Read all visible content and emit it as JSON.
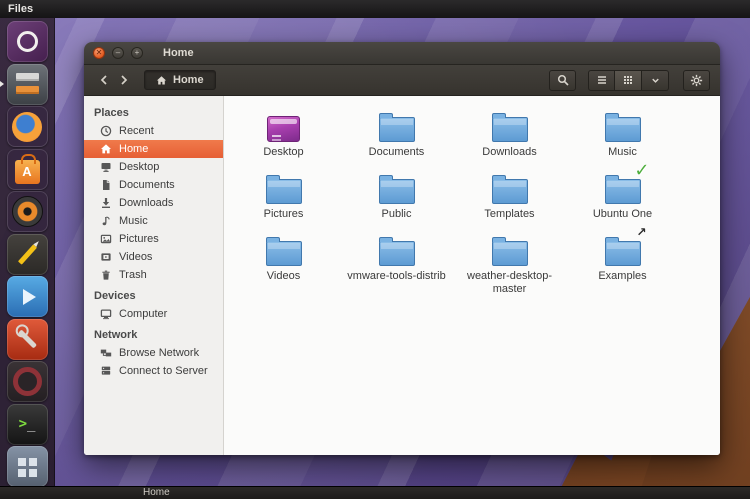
{
  "top_bar": {
    "app_name": "Files"
  },
  "bottom_bar": {
    "label": "Home"
  },
  "dock": {
    "items": [
      {
        "icon": "ubuntu-dash-icon"
      },
      {
        "icon": "files-app-icon"
      },
      {
        "icon": "firefox-icon"
      },
      {
        "icon": "software-center-icon"
      },
      {
        "icon": "rhythmbox-icon"
      },
      {
        "icon": "pencil-app-icon"
      },
      {
        "icon": "video-player-icon"
      },
      {
        "icon": "system-settings-icon"
      },
      {
        "icon": "ubuntu-one-icon"
      },
      {
        "icon": "terminal-icon"
      },
      {
        "icon": "workspace-switcher-icon"
      }
    ]
  },
  "window": {
    "title": "Home",
    "toolbar": {
      "location": "Home"
    },
    "sidebar": {
      "sections": [
        {
          "heading": "Places",
          "items": [
            {
              "label": "Recent"
            },
            {
              "label": "Home",
              "selected": true
            },
            {
              "label": "Desktop"
            },
            {
              "label": "Documents"
            },
            {
              "label": "Downloads"
            },
            {
              "label": "Music"
            },
            {
              "label": "Pictures"
            },
            {
              "label": "Videos"
            },
            {
              "label": "Trash"
            }
          ]
        },
        {
          "heading": "Devices",
          "items": [
            {
              "label": "Computer"
            }
          ]
        },
        {
          "heading": "Network",
          "items": [
            {
              "label": "Browse Network"
            },
            {
              "label": "Connect to Server"
            }
          ]
        }
      ]
    },
    "files": [
      {
        "label": "Desktop",
        "icon": "desktop-folder"
      },
      {
        "label": "Documents",
        "icon": "folder"
      },
      {
        "label": "Downloads",
        "icon": "folder"
      },
      {
        "label": "Music",
        "icon": "folder"
      },
      {
        "label": "Pictures",
        "icon": "folder"
      },
      {
        "label": "Public",
        "icon": "folder"
      },
      {
        "label": "Templates",
        "icon": "folder"
      },
      {
        "label": "Ubuntu One",
        "icon": "folder",
        "emblem": "check"
      },
      {
        "label": "Videos",
        "icon": "folder"
      },
      {
        "label": "vmware-tools-distrib",
        "icon": "folder"
      },
      {
        "label": "weather-desktop-master",
        "icon": "folder"
      },
      {
        "label": "Examples",
        "icon": "folder",
        "emblem": "link"
      }
    ]
  },
  "colors": {
    "accent": "#E95420",
    "selection": "#ED6B3F",
    "folder_blue": "#5D9BD3"
  }
}
